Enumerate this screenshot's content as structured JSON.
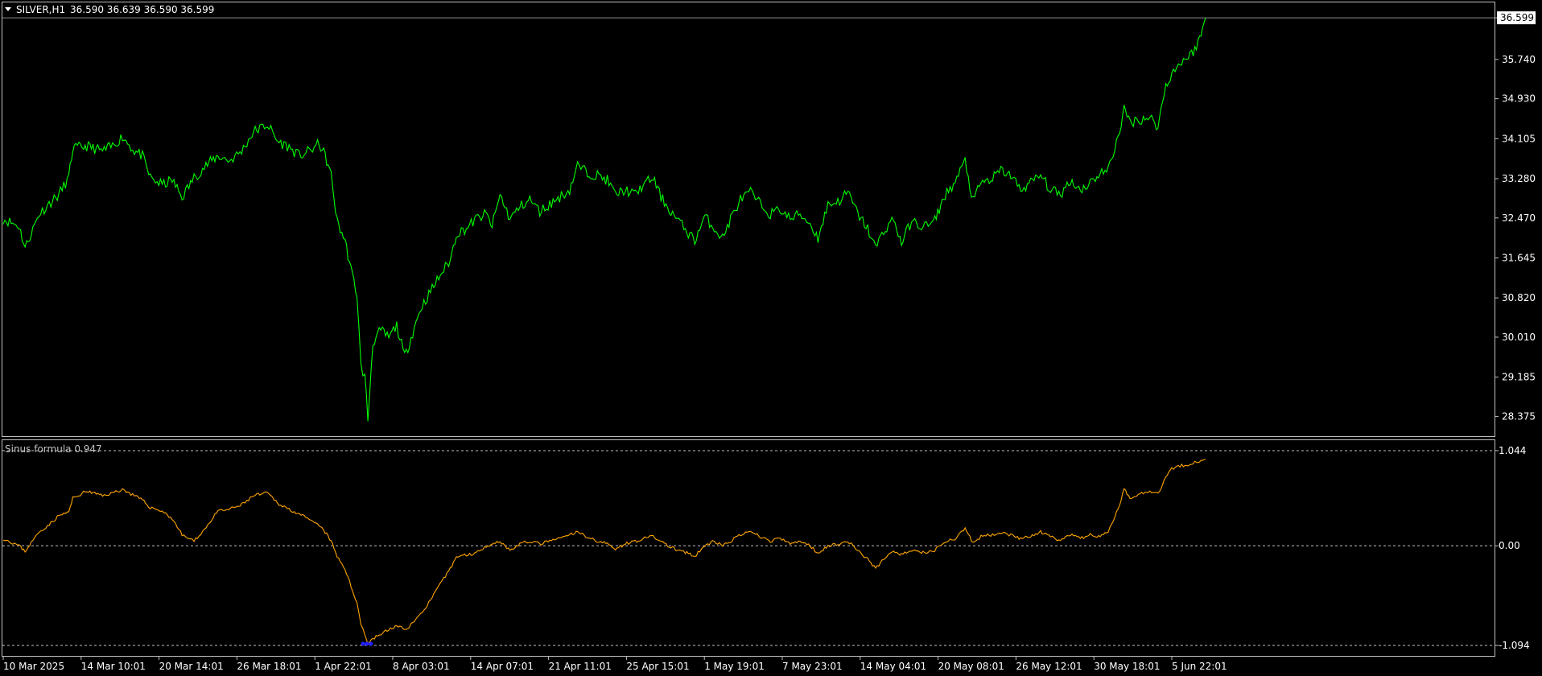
{
  "header": {
    "symbol": "SILVER,H1",
    "ohlc": "36.590 36.639 36.590 36.599"
  },
  "indicator": {
    "label": "Sinus formula 0.947"
  },
  "colors": {
    "background": "#000000",
    "price_line": "#00ff00",
    "indicator_line": "#ffa500",
    "frame": "#c0c0c0",
    "marker": "#2020ff"
  },
  "chart_data": [
    {
      "type": "line",
      "title": "SILVER,H1",
      "series": [
        {
          "name": "",
          "x": [
            "10 Mar 2025",
            "14 Mar 10:01",
            "20 Mar 14:01",
            "26 Mar 18:01",
            "1 Apr 22:01",
            "8 Apr 03:01",
            "14 Apr 07:01",
            "21 Apr 11:01",
            "25 Apr 15:01",
            "1 May 19:01",
            "7 May 23:01",
            "14 May 04:01",
            "20 May 08:01",
            "26 May 12:01",
            "30 May 18:01",
            "5 Jun 22:01"
          ],
          "anchors": [
            [
              0,
              32.45
            ],
            [
              0.8,
              32.3
            ],
            [
              1.1,
              31.85
            ],
            [
              1.8,
              32.55
            ],
            [
              2.4,
              32.8
            ],
            [
              2.8,
              32.95
            ],
            [
              3.3,
              33.3
            ],
            [
              3.5,
              33.9
            ],
            [
              4.2,
              33.95
            ],
            [
              5.0,
              33.85
            ],
            [
              5.5,
              33.95
            ],
            [
              6.0,
              34.15
            ],
            [
              6.6,
              33.85
            ],
            [
              7.0,
              33.75
            ],
            [
              7.4,
              33.3
            ],
            [
              8.0,
              33.15
            ],
            [
              8.5,
              33.25
            ],
            [
              9.0,
              32.9
            ],
            [
              9.6,
              33.3
            ],
            [
              10.2,
              33.55
            ],
            [
              10.8,
              33.75
            ],
            [
              11.4,
              33.65
            ],
            [
              12.0,
              33.85
            ],
            [
              12.6,
              34.25
            ],
            [
              13.3,
              34.4
            ],
            [
              13.8,
              34.05
            ],
            [
              14.3,
              33.95
            ],
            [
              14.9,
              33.75
            ],
            [
              15.4,
              33.85
            ],
            [
              15.9,
              34.0
            ],
            [
              16.2,
              33.75
            ],
            [
              16.5,
              33.35
            ],
            [
              16.8,
              32.4
            ],
            [
              17.2,
              32.0
            ],
            [
              17.5,
              31.4
            ],
            [
              17.8,
              30.9
            ],
            [
              18.0,
              29.4
            ],
            [
              18.2,
              29.2
            ],
            [
              18.35,
              28.3
            ],
            [
              18.6,
              29.9
            ],
            [
              19.0,
              30.15
            ],
            [
              19.4,
              30.0
            ],
            [
              19.8,
              30.25
            ],
            [
              20.2,
              29.6
            ],
            [
              20.6,
              30.1
            ],
            [
              21.0,
              30.6
            ],
            [
              21.5,
              30.95
            ],
            [
              22.0,
              31.3
            ],
            [
              22.5,
              31.6
            ],
            [
              22.8,
              32.15
            ],
            [
              23.3,
              32.25
            ],
            [
              23.8,
              32.45
            ],
            [
              24.3,
              32.55
            ],
            [
              24.6,
              32.3
            ],
            [
              25.0,
              32.95
            ],
            [
              25.5,
              32.45
            ],
            [
              26.0,
              32.7
            ],
            [
              26.5,
              32.85
            ],
            [
              27.0,
              32.6
            ],
            [
              27.5,
              32.75
            ],
            [
              28.0,
              32.9
            ],
            [
              28.5,
              33.05
            ],
            [
              28.9,
              33.55
            ],
            [
              29.4,
              33.4
            ],
            [
              29.9,
              33.35
            ],
            [
              30.4,
              33.25
            ],
            [
              30.8,
              32.95
            ],
            [
              31.3,
              33.05
            ],
            [
              31.8,
              32.95
            ],
            [
              32.2,
              33.15
            ],
            [
              32.7,
              33.3
            ],
            [
              33.1,
              32.9
            ],
            [
              33.6,
              32.6
            ],
            [
              34.0,
              32.4
            ],
            [
              34.4,
              32.2
            ],
            [
              34.8,
              32.0
            ],
            [
              35.3,
              32.5
            ],
            [
              35.7,
              32.3
            ],
            [
              36.2,
              32.05
            ],
            [
              36.6,
              32.45
            ],
            [
              37.1,
              32.85
            ],
            [
              37.6,
              33.0
            ],
            [
              38.1,
              32.75
            ],
            [
              38.6,
              32.55
            ],
            [
              39.1,
              32.65
            ],
            [
              39.6,
              32.45
            ],
            [
              40.1,
              32.55
            ],
            [
              40.6,
              32.35
            ],
            [
              41.0,
              32.05
            ],
            [
              41.5,
              32.75
            ],
            [
              42.0,
              32.8
            ],
            [
              42.5,
              33.0
            ],
            [
              43.0,
              32.55
            ],
            [
              43.5,
              32.25
            ],
            [
              43.9,
              31.85
            ],
            [
              44.3,
              32.2
            ],
            [
              44.8,
              32.45
            ],
            [
              45.2,
              31.95
            ],
            [
              45.7,
              32.4
            ],
            [
              46.2,
              32.3
            ],
            [
              46.8,
              32.35
            ],
            [
              47.4,
              32.95
            ],
            [
              47.9,
              33.2
            ],
            [
              48.4,
              33.65
            ],
            [
              48.8,
              32.8
            ],
            [
              49.2,
              33.2
            ],
            [
              49.7,
              33.25
            ],
            [
              50.2,
              33.45
            ],
            [
              50.7,
              33.35
            ],
            [
              51.2,
              33.05
            ],
            [
              51.7,
              33.2
            ],
            [
              52.2,
              33.35
            ],
            [
              52.7,
              33.05
            ],
            [
              53.2,
              32.95
            ],
            [
              53.7,
              33.25
            ],
            [
              54.2,
              33.05
            ],
            [
              54.7,
              33.2
            ],
            [
              55.2,
              33.4
            ],
            [
              55.6,
              33.45
            ],
            [
              56.1,
              34.15
            ],
            [
              56.4,
              34.7
            ],
            [
              56.7,
              34.45
            ],
            [
              57.2,
              34.5
            ],
            [
              57.7,
              34.55
            ],
            [
              58.1,
              34.35
            ],
            [
              58.5,
              35.2
            ],
            [
              58.8,
              35.45
            ],
            [
              59.3,
              35.7
            ],
            [
              59.8,
              35.85
            ],
            [
              60.2,
              36.15
            ],
            [
              60.5,
              36.6
            ]
          ]
        }
      ],
      "ylim": [
        28.0,
        36.9
      ],
      "y_ticks": [
        "36.599",
        "35.740",
        "34.930",
        "34.105",
        "33.280",
        "32.470",
        "31.645",
        "30.820",
        "30.010",
        "29.185",
        "28.375"
      ],
      "current_price": "36.599",
      "grid": false
    },
    {
      "type": "line",
      "title": "Sinus formula 0.947",
      "series": [
        {
          "name": "",
          "anchors": [
            [
              0,
              0.08
            ],
            [
              0.8,
              0.0
            ],
            [
              1.1,
              -0.06
            ],
            [
              1.8,
              0.15
            ],
            [
              2.4,
              0.25
            ],
            [
              2.8,
              0.33
            ],
            [
              3.3,
              0.37
            ],
            [
              3.5,
              0.52
            ],
            [
              4.2,
              0.6
            ],
            [
              5.0,
              0.55
            ],
            [
              5.5,
              0.58
            ],
            [
              6.0,
              0.62
            ],
            [
              6.6,
              0.55
            ],
            [
              7.0,
              0.5
            ],
            [
              7.4,
              0.42
            ],
            [
              8.0,
              0.38
            ],
            [
              8.5,
              0.3
            ],
            [
              9.0,
              0.12
            ],
            [
              9.6,
              0.05
            ],
            [
              10.2,
              0.2
            ],
            [
              10.8,
              0.38
            ],
            [
              11.4,
              0.4
            ],
            [
              12.0,
              0.45
            ],
            [
              12.6,
              0.55
            ],
            [
              13.3,
              0.58
            ],
            [
              13.8,
              0.47
            ],
            [
              14.3,
              0.41
            ],
            [
              14.9,
              0.35
            ],
            [
              15.4,
              0.28
            ],
            [
              15.9,
              0.22
            ],
            [
              16.2,
              0.15
            ],
            [
              16.5,
              0.05
            ],
            [
              16.8,
              -0.12
            ],
            [
              17.2,
              -0.25
            ],
            [
              17.5,
              -0.45
            ],
            [
              17.8,
              -0.62
            ],
            [
              18.0,
              -0.85
            ],
            [
              18.2,
              -0.98
            ],
            [
              18.35,
              -1.07
            ],
            [
              18.6,
              -1.02
            ],
            [
              19.0,
              -0.97
            ],
            [
              19.4,
              -0.92
            ],
            [
              19.8,
              -0.88
            ],
            [
              20.2,
              -0.92
            ],
            [
              20.6,
              -0.85
            ],
            [
              21.0,
              -0.75
            ],
            [
              21.5,
              -0.6
            ],
            [
              22.0,
              -0.42
            ],
            [
              22.5,
              -0.25
            ],
            [
              22.8,
              -0.12
            ],
            [
              23.3,
              -0.1
            ],
            [
              23.8,
              -0.08
            ],
            [
              24.3,
              0.0
            ],
            [
              24.6,
              0.02
            ],
            [
              25.0,
              0.05
            ],
            [
              25.5,
              -0.05
            ],
            [
              26.0,
              0.02
            ],
            [
              26.5,
              0.05
            ],
            [
              27.0,
              0.02
            ],
            [
              27.5,
              0.05
            ],
            [
              28.0,
              0.08
            ],
            [
              28.5,
              0.12
            ],
            [
              28.9,
              0.15
            ],
            [
              29.4,
              0.1
            ],
            [
              29.9,
              0.05
            ],
            [
              30.4,
              0.02
            ],
            [
              30.8,
              -0.03
            ],
            [
              31.3,
              0.02
            ],
            [
              31.8,
              0.05
            ],
            [
              32.2,
              0.08
            ],
            [
              32.7,
              0.1
            ],
            [
              33.1,
              0.05
            ],
            [
              33.6,
              -0.02
            ],
            [
              34.0,
              -0.05
            ],
            [
              34.4,
              -0.08
            ],
            [
              34.8,
              -0.12
            ],
            [
              35.3,
              0.0
            ],
            [
              35.7,
              0.05
            ],
            [
              36.2,
              0.0
            ],
            [
              36.6,
              0.05
            ],
            [
              37.1,
              0.12
            ],
            [
              37.6,
              0.15
            ],
            [
              38.1,
              0.1
            ],
            [
              38.6,
              0.05
            ],
            [
              39.1,
              0.08
            ],
            [
              39.6,
              0.02
            ],
            [
              40.1,
              0.05
            ],
            [
              40.6,
              0.0
            ],
            [
              41.0,
              -0.08
            ],
            [
              41.5,
              0.0
            ],
            [
              42.0,
              0.02
            ],
            [
              42.5,
              0.05
            ],
            [
              43.0,
              -0.05
            ],
            [
              43.5,
              -0.15
            ],
            [
              43.9,
              -0.25
            ],
            [
              44.3,
              -0.15
            ],
            [
              44.8,
              -0.05
            ],
            [
              45.2,
              -0.1
            ],
            [
              45.7,
              -0.05
            ],
            [
              46.2,
              -0.08
            ],
            [
              46.8,
              -0.06
            ],
            [
              47.4,
              0.05
            ],
            [
              47.9,
              0.08
            ],
            [
              48.4,
              0.18
            ],
            [
              48.8,
              0.03
            ],
            [
              49.2,
              0.1
            ],
            [
              49.7,
              0.12
            ],
            [
              50.2,
              0.15
            ],
            [
              50.7,
              0.12
            ],
            [
              51.2,
              0.08
            ],
            [
              51.7,
              0.1
            ],
            [
              52.2,
              0.15
            ],
            [
              52.7,
              0.1
            ],
            [
              53.2,
              0.05
            ],
            [
              53.7,
              0.12
            ],
            [
              54.2,
              0.08
            ],
            [
              54.7,
              0.12
            ],
            [
              55.2,
              0.1
            ],
            [
              55.6,
              0.15
            ],
            [
              56.1,
              0.4
            ],
            [
              56.4,
              0.62
            ],
            [
              56.7,
              0.52
            ],
            [
              57.2,
              0.58
            ],
            [
              57.7,
              0.6
            ],
            [
              58.1,
              0.57
            ],
            [
              58.5,
              0.75
            ],
            [
              58.8,
              0.85
            ],
            [
              59.3,
              0.88
            ],
            [
              59.8,
              0.9
            ],
            [
              60.2,
              0.93
            ],
            [
              60.5,
              0.95
            ]
          ]
        }
      ],
      "ylim": [
        -1.2,
        1.15
      ],
      "y_ticks": [
        "1.044",
        "0.00",
        "-1.094"
      ],
      "levels": [
        1.044,
        0.0,
        -1.094
      ],
      "grid": false
    }
  ]
}
